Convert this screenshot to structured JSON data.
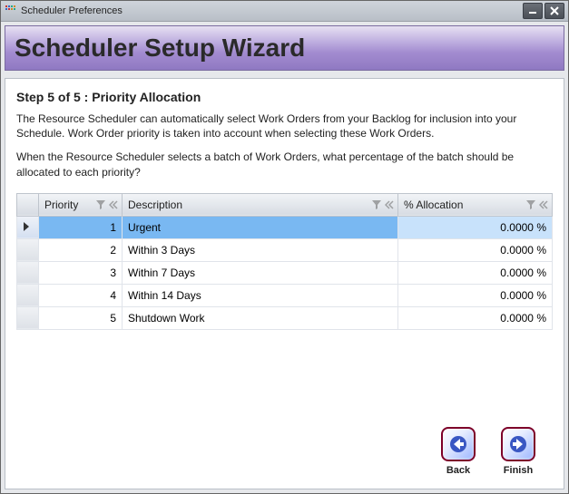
{
  "window": {
    "title": "Scheduler Preferences"
  },
  "header": {
    "wizard_title": "Scheduler Setup Wizard"
  },
  "step": {
    "title": "Step 5 of 5 : Priority Allocation",
    "intro1": "The Resource Scheduler can automatically select Work Orders from your Backlog for inclusion into your Schedule. Work Order priority is taken into account when selecting these Work Orders.",
    "intro2": "When the Resource Scheduler selects a batch of Work Orders, what percentage of the batch should be allocated to each priority?"
  },
  "grid": {
    "columns": {
      "priority": "Priority",
      "description": "Description",
      "allocation": "% Allocation"
    },
    "rows": [
      {
        "priority": "1",
        "description": "Urgent",
        "allocation": "0.0000 %",
        "selected": true
      },
      {
        "priority": "2",
        "description": "Within 3 Days",
        "allocation": "0.0000 %",
        "selected": false
      },
      {
        "priority": "3",
        "description": "Within 7 Days",
        "allocation": "0.0000 %",
        "selected": false
      },
      {
        "priority": "4",
        "description": "Within 14 Days",
        "allocation": "0.0000 %",
        "selected": false
      },
      {
        "priority": "5",
        "description": "Shutdown Work",
        "allocation": "0.0000 %",
        "selected": false
      }
    ]
  },
  "footer": {
    "back_label": "Back",
    "finish_label": "Finish"
  }
}
